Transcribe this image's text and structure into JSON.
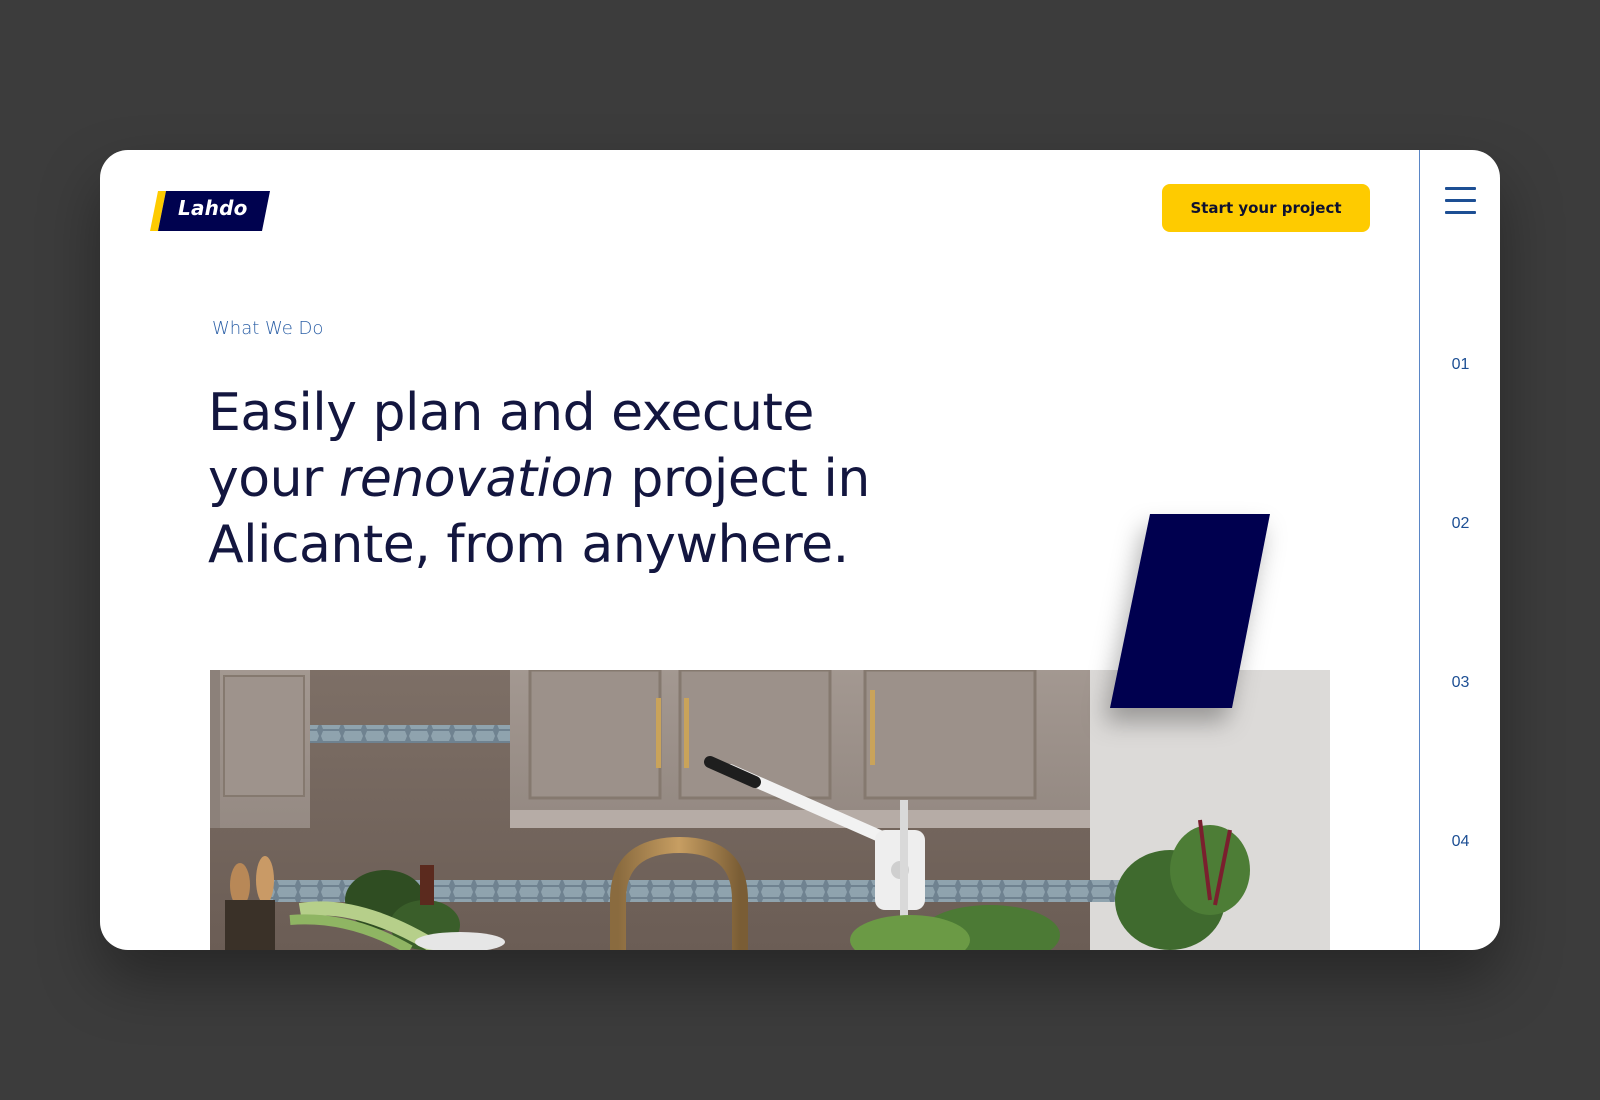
{
  "brand": {
    "name": "Lahdo",
    "primary_color": "#00024f",
    "accent_color": "#fecb00"
  },
  "header": {
    "cta_label": "Start your project"
  },
  "rail": {
    "menu_icon": "hamburger-menu-icon",
    "items": [
      "01",
      "02",
      "03",
      "04"
    ]
  },
  "hero": {
    "eyebrow": "What We Do",
    "headline_part1": "Easily plan and execute your ",
    "headline_emphasis": "renovation",
    "headline_part2": " project in Alicante, from anywhere."
  }
}
